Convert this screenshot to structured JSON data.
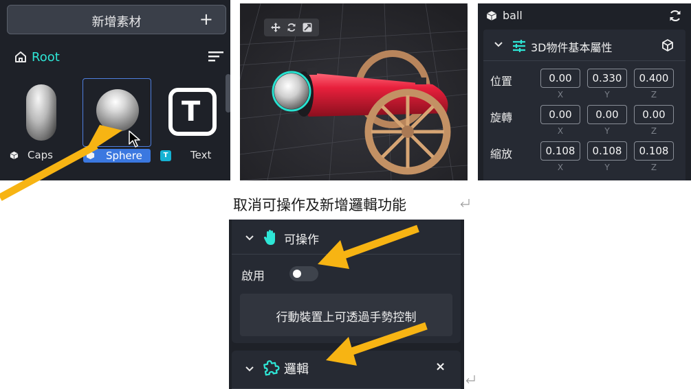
{
  "asset_panel": {
    "add_button_label": "新增素材",
    "add_button_plus": "+",
    "root_label": "Root",
    "items": [
      {
        "label": "Capsule",
        "visible_label": "Caps"
      },
      {
        "label": "Sphere",
        "selected": true
      },
      {
        "label": "Text",
        "badge": "T"
      }
    ]
  },
  "viewport": {
    "toolbar_icons": [
      "move-icon",
      "rotate-icon",
      "scale-icon"
    ]
  },
  "properties": {
    "object_name": "ball",
    "section_title": "3D物件基本屬性",
    "axes": [
      "X",
      "Y",
      "Z"
    ],
    "rows": [
      {
        "label": "位置",
        "values": [
          "0.00",
          "0.330",
          "0.400"
        ]
      },
      {
        "label": "旋轉",
        "values": [
          "0.00",
          "0.00",
          "0.00"
        ]
      },
      {
        "label": "縮放",
        "values": [
          "0.108",
          "0.108",
          "0.108"
        ]
      }
    ]
  },
  "caption": "取消可操作及新增邏輯功能",
  "operable_panel": {
    "section_title": "可操作",
    "enable_label": "啟用",
    "enabled": false,
    "hint": "行動裝置上可透過手勢控制"
  },
  "logic_panel": {
    "section_title": "邏輯",
    "close_symbol": "×"
  },
  "colors": {
    "accent_teal": "#2ee6d6",
    "selection_blue": "#3b78e0",
    "arrow_orange": "#f7b413",
    "panel_bg": "#1e2128",
    "cannon_red": "#e8203c"
  }
}
